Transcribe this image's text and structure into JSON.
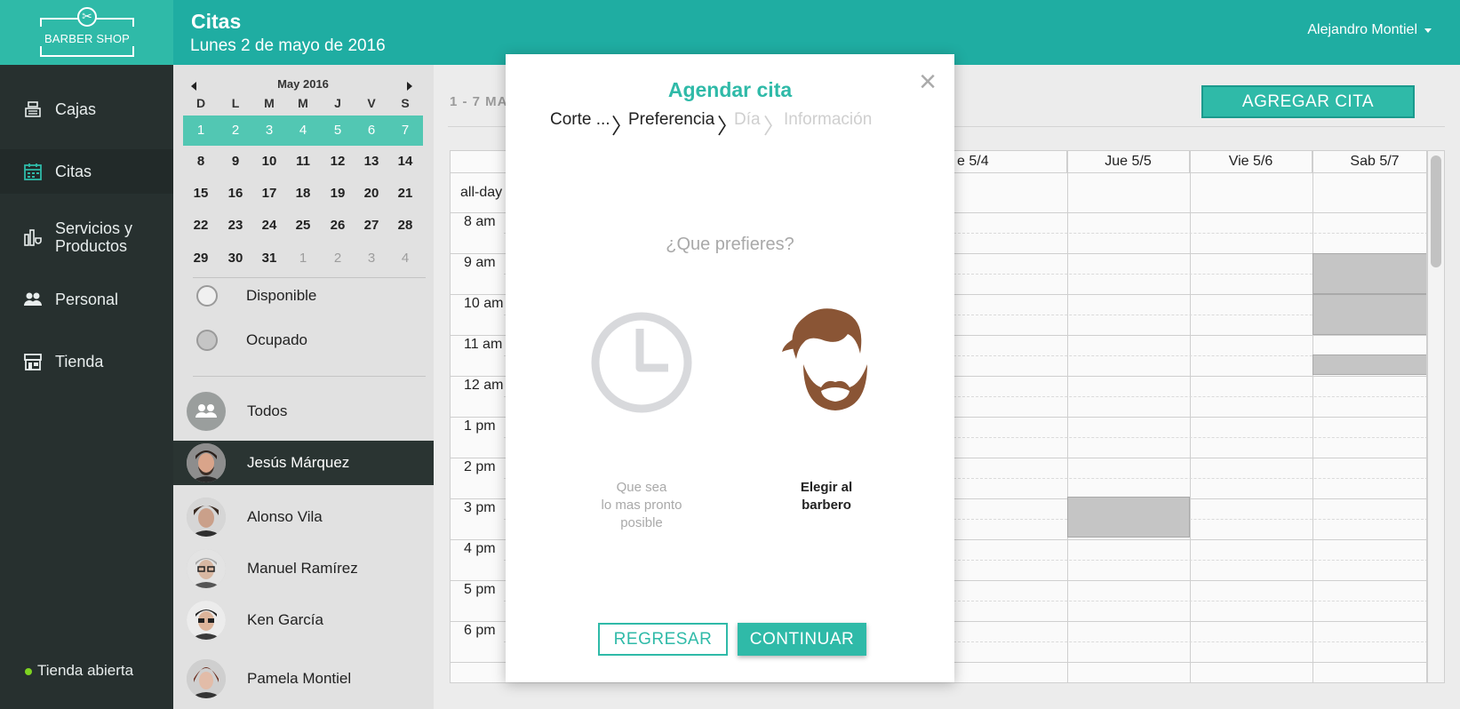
{
  "app": {
    "logo_text": "BARBER SHOP",
    "brand_color": "#2fbaa8"
  },
  "header": {
    "title": "Citas",
    "date": "Lunes 2 de mayo de 2016",
    "user": "Alejandro Montiel"
  },
  "sidebar": {
    "items": [
      {
        "label": "Cajas",
        "icon": "cash-register-icon"
      },
      {
        "label": "Citas",
        "icon": "calendar-icon",
        "active": true
      },
      {
        "label": "Servicios y",
        "label2": "Productos",
        "icon": "products-icon"
      },
      {
        "label": "Personal",
        "icon": "people-icon"
      },
      {
        "label": "Tienda",
        "icon": "store-icon"
      }
    ],
    "status": "Tienda abierta"
  },
  "mini_calendar": {
    "month": "May 2016",
    "weekdays": [
      "D",
      "L",
      "M",
      "M",
      "J",
      "V",
      "S"
    ],
    "weeks": [
      [
        "1",
        "2",
        "3",
        "4",
        "5",
        "6",
        "7"
      ],
      [
        "8",
        "9",
        "10",
        "11",
        "12",
        "13",
        "14"
      ],
      [
        "15",
        "16",
        "17",
        "18",
        "19",
        "20",
        "21"
      ],
      [
        "22",
        "23",
        "24",
        "25",
        "26",
        "27",
        "28"
      ],
      [
        "29",
        "30",
        "31",
        "1",
        "2",
        "3",
        "4"
      ]
    ],
    "highlighted_week": 0
  },
  "legend": {
    "available": "Disponible",
    "busy": "Ocupado"
  },
  "barbers": [
    {
      "name": "Todos"
    },
    {
      "name": "Jesús Márquez",
      "active": true
    },
    {
      "name": "Alonso Vila"
    },
    {
      "name": "Manuel Ramírez"
    },
    {
      "name": "Ken García"
    },
    {
      "name": "Pamela Montiel"
    }
  ],
  "calendar": {
    "range": "1 - 7  MA",
    "add_button": "AGREGAR CITA",
    "columns": [
      "e 5/4",
      "Jue 5/5",
      "Vie 5/6",
      "Sab 5/7"
    ],
    "allday": "all-day",
    "times": [
      "8 am",
      "9 am",
      "10 am",
      "11 am",
      "12 am",
      "1 pm",
      "2 pm",
      "3 pm",
      "4 pm",
      "5 pm",
      "6 pm"
    ]
  },
  "modal": {
    "title": "Agendar cita",
    "close": "×",
    "steps": [
      "Corte ...",
      "Preferencia",
      "Día",
      "Información"
    ],
    "question": "¿Que prefieres?",
    "option_soon": [
      "Que sea",
      "lo mas pronto",
      "posible"
    ],
    "option_barber": [
      "Elegir al",
      "barbero"
    ],
    "back": "REGRESAR",
    "continue": "CONTINUAR"
  }
}
